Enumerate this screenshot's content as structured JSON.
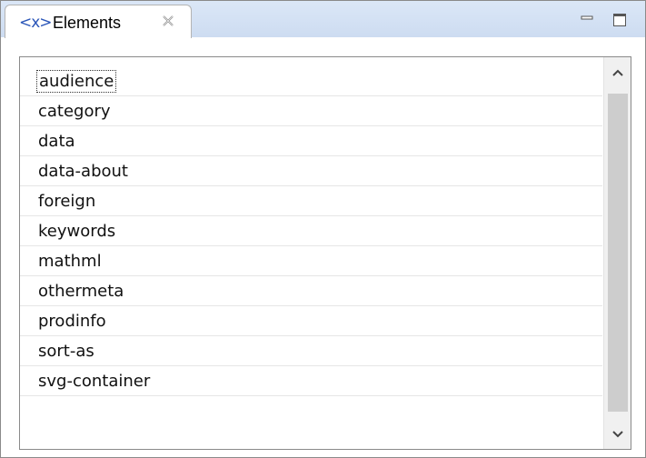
{
  "panel": {
    "tab_icon": "<x>",
    "tab_title": "Elements",
    "tab_close_icon": "close-icon",
    "minimize_icon": "minimize-icon",
    "maximize_icon": "maximize-icon"
  },
  "list": {
    "selected_index": 0,
    "items": [
      "audience",
      "category",
      "data",
      "data-about",
      "foreign",
      "keywords",
      "mathml",
      "othermeta",
      "prodinfo",
      "sort-as",
      "svg-container"
    ]
  },
  "scrollbar": {
    "up_icon": "chevron-up-icon",
    "down_icon": "chevron-down-icon"
  },
  "colors": {
    "accent": "#2a55b8",
    "titlebar": "#cddcf1",
    "thumb": "#cdcdcd"
  }
}
